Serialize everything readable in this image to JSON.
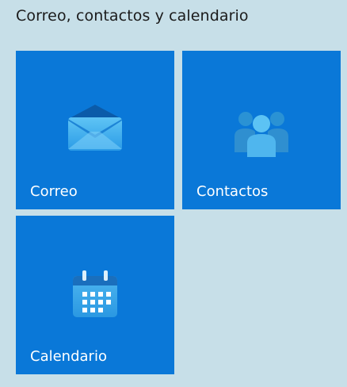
{
  "group": {
    "title": "Correo, contactos y calendario"
  },
  "tiles": [
    {
      "label": "Correo",
      "icon": "mail-icon"
    },
    {
      "label": "Contactos",
      "icon": "contacts-icon"
    },
    {
      "label": "Calendario",
      "icon": "calendar-icon"
    }
  ],
  "colors": {
    "background": "#c7dfe8",
    "tile": "#0a78d8",
    "title_text": "#1b1b1b",
    "tile_text": "#ffffff"
  }
}
